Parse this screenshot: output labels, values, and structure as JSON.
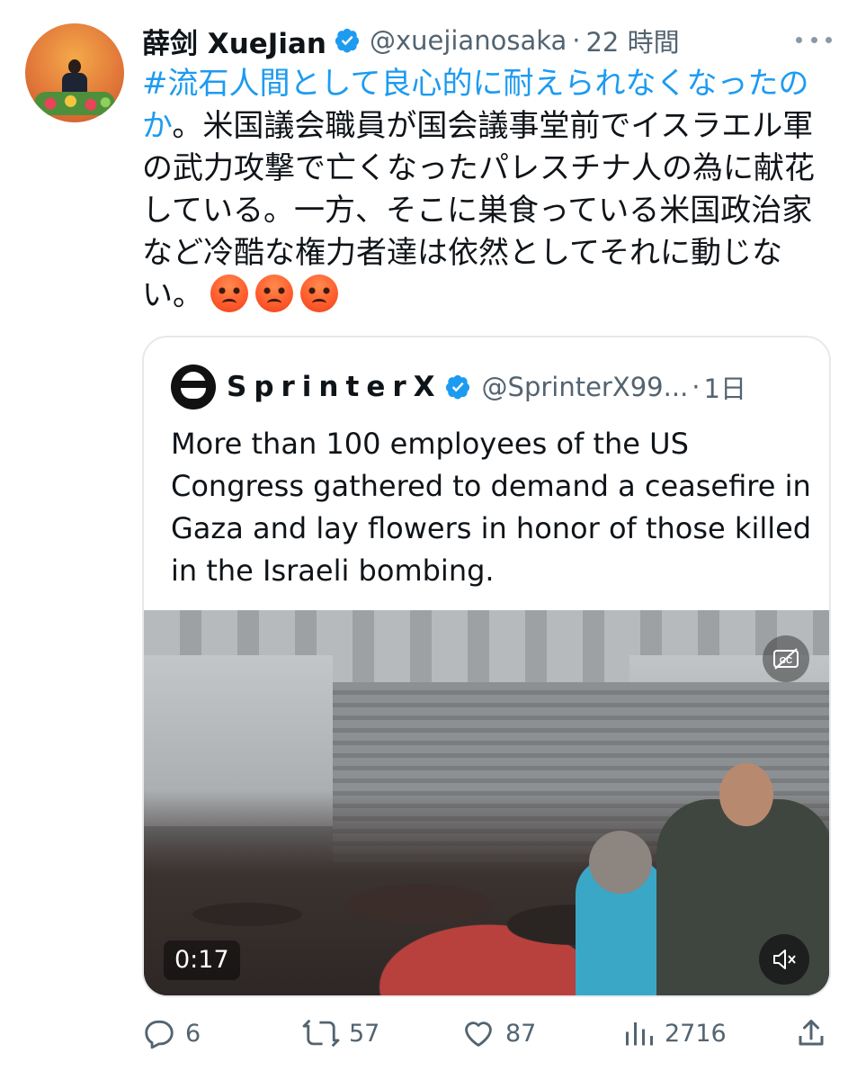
{
  "tweet": {
    "author_name": "薛剑 XueJian",
    "author_handle": "@xuejianosaka",
    "separator": "·",
    "time": "22 時間",
    "hashtag": "#流石人間として良心的に耐えられなくなったのか",
    "body_text": "。米国議会職員が国会議事堂前でイスラエル軍の武力攻撃で亡くなったパレスチナ人の為に献花している。一方、そこに巣食っている米国政治家など冷酷な権力者達は依然としてそれに動じない。",
    "emojis": [
      "angry-face-icon",
      "angry-face-icon",
      "angry-face-icon"
    ]
  },
  "quote": {
    "author_name": "SprinterX",
    "author_handle": "@SprinterX99...",
    "separator": "·",
    "time": "1日",
    "text": "More than 100 employees of the US Congress gathered to demand a ceasefire in Gaza and lay flowers in honor of those killed in the Israeli bombing.",
    "video": {
      "duration": "0:17",
      "cc_icon": "captions-off-icon",
      "mute_icon": "muted-speaker-icon"
    }
  },
  "actions": {
    "reply_count": "6",
    "retweet_count": "57",
    "like_count": "87",
    "views_count": "2716"
  },
  "colors": {
    "link": "#1d9bf0",
    "secondary_text": "#536471",
    "verified": "#1d9bf0",
    "border": "#e6e9eb"
  }
}
